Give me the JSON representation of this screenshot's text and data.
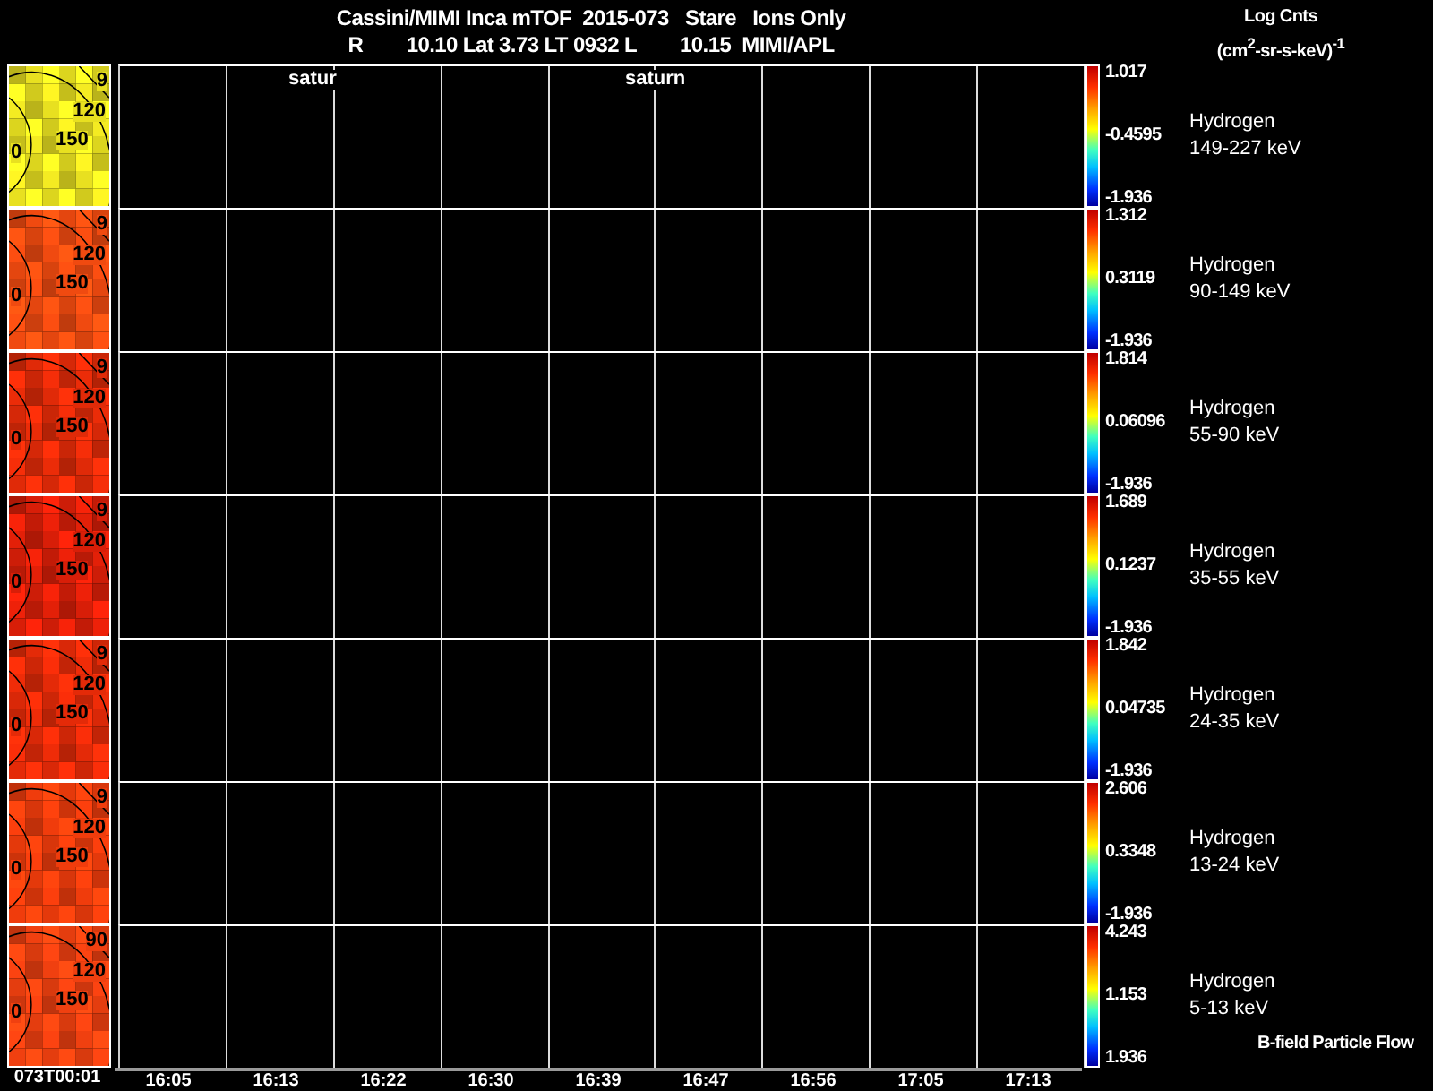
{
  "header": {
    "title": "Cassini/MIMI Inca mTOF  2015-073   Stare   Ions Only",
    "subtitle": "R        10.10 Lat 3.73 LT 0932 L        10.15  MIMI/APL",
    "units_title": "Log Cnts",
    "units": "(cm$^{2}$-sr-s-keV)$^{-1}$"
  },
  "plot_labels": [
    "satur",
    "saturn"
  ],
  "panels": [
    {
      "color": "#e8e020",
      "contours": [
        "9",
        "120",
        "150",
        "0"
      ],
      "max": "1.017",
      "mid": "-0.4595",
      "min": "-1.936",
      "species": "Hydrogen",
      "energy": "149-227 keV"
    },
    {
      "color": "#f04a10",
      "contours": [
        "9",
        "120",
        "150",
        "0"
      ],
      "max": "1.312",
      "mid": "0.3119",
      "min": "-1.936",
      "species": "Hydrogen",
      "energy": "90-149 keV"
    },
    {
      "color": "#e02a08",
      "contours": [
        "9",
        "120",
        "150",
        "0"
      ],
      "max": "1.814",
      "mid": "0.06096",
      "min": "-1.936",
      "species": "Hydrogen",
      "energy": "55-90 keV"
    },
    {
      "color": "#d81e08",
      "contours": [
        "9",
        "120",
        "150",
        "0"
      ],
      "max": "1.689",
      "mid": "0.1237",
      "min": "-1.936",
      "species": "Hydrogen",
      "energy": "35-55 keV"
    },
    {
      "color": "#e42a08",
      "contours": [
        "9",
        "120",
        "150",
        "0"
      ],
      "max": "1.842",
      "mid": "0.04735",
      "min": "-1.936",
      "species": "Hydrogen",
      "energy": "24-35 keV"
    },
    {
      "color": "#f03c0c",
      "contours": [
        "9",
        "120",
        "150",
        "0"
      ],
      "max": "2.606",
      "mid": "0.3348",
      "min": "-1.936",
      "species": "Hydrogen",
      "energy": "13-24 keV"
    },
    {
      "color": "#f04010",
      "contours": [
        "90",
        "120",
        "150",
        "0"
      ],
      "max": "4.243",
      "mid": "1.153",
      "min": "1.936",
      "species": "Hydrogen",
      "energy": "5-13 keV",
      "note": "B-field Particle Flow"
    }
  ],
  "time_axis": {
    "start": "073T00:01",
    "ticks": [
      "16:05",
      "16:13",
      "16:22",
      "16:30",
      "16:39",
      "16:47",
      "16:56",
      "17:05",
      "17:13"
    ]
  }
}
